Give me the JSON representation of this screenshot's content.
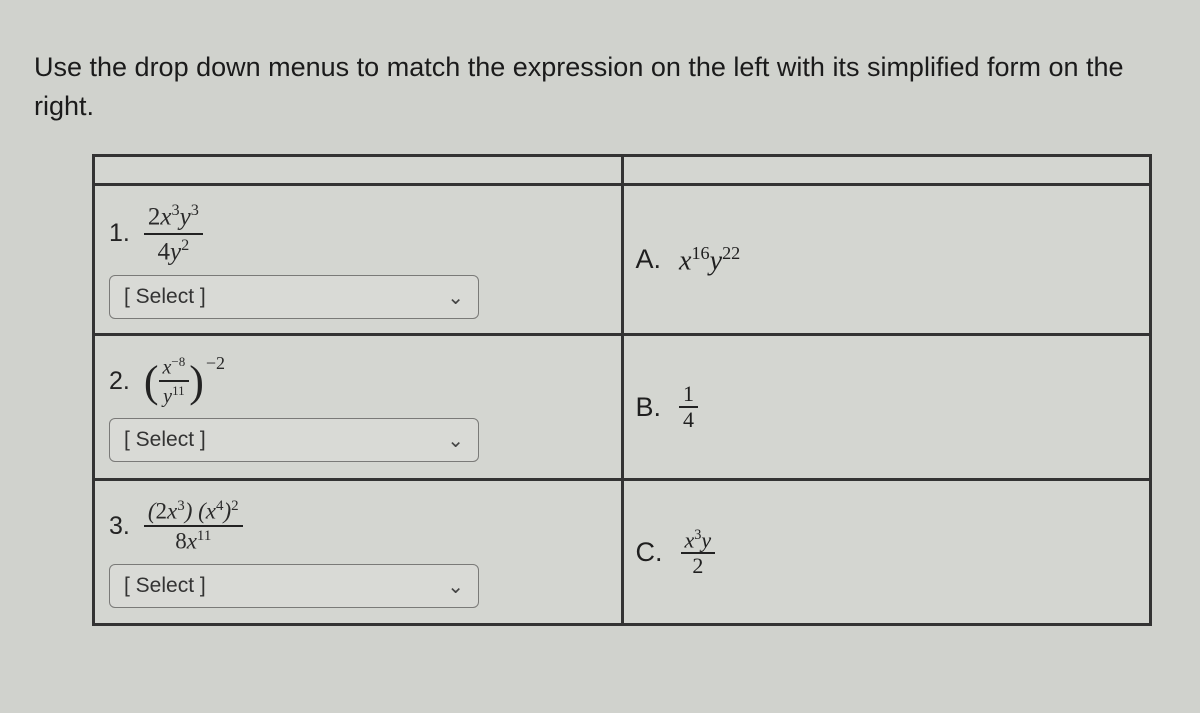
{
  "instructions": "Use the drop down menus to match the expression on the left with its simplified form on the right.",
  "rows": [
    {
      "num": "1.",
      "expr_num_coeff": "2",
      "expr_num_v1": "x",
      "expr_num_e1": "3",
      "expr_num_v2": "y",
      "expr_num_e2": "3",
      "expr_den_coeff": "4",
      "expr_den_v1": "y",
      "expr_den_e1": "2",
      "select": "[ Select ]",
      "ans_letter": "A.",
      "ans_v1": "x",
      "ans_e1": "16",
      "ans_v2": "y",
      "ans_e2": "22"
    },
    {
      "num": "2.",
      "inner_num_v": "x",
      "inner_num_e": "−8",
      "inner_den_v": "y",
      "inner_den_e": "11",
      "outer_e": "−2",
      "select": "[ Select ]",
      "ans_letter": "B.",
      "ans_frac_n": "1",
      "ans_frac_d": "4"
    },
    {
      "num": "3.",
      "p1_coeff": "2",
      "p1_v": "x",
      "p1_e": "3",
      "p2_v": "x",
      "p2_e": "4",
      "p2_out_e": "2",
      "den_coeff": "8",
      "den_v": "x",
      "den_e": "11",
      "select": "[ Select ]",
      "ans_letter": "C.",
      "ans_num_v1": "x",
      "ans_num_e1": "3",
      "ans_num_v2": "y",
      "ans_den": "2"
    }
  ]
}
